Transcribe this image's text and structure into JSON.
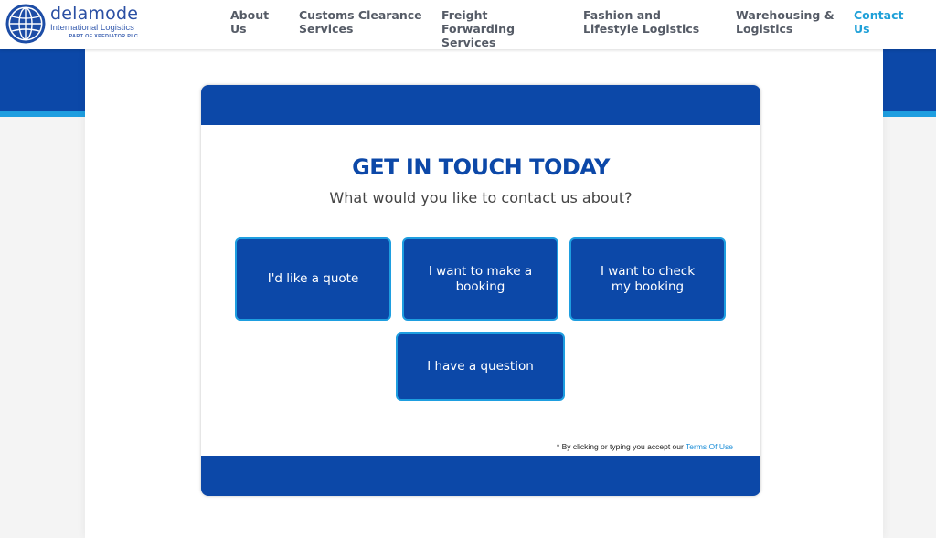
{
  "header": {
    "brand_name": "delamode",
    "brand_sub": "International Logistics",
    "brand_tag": "PART OF XPEDIATOR PLC",
    "nav": [
      {
        "label": "About Us"
      },
      {
        "label": "Customs Clearance Services"
      },
      {
        "label": "Freight Forwarding Services"
      },
      {
        "label": "Fashion and Lifestyle Logistics"
      },
      {
        "label": "Warehousing & Logistics"
      },
      {
        "label": "Contact Us",
        "active": true
      }
    ]
  },
  "contact": {
    "title": "GET IN TOUCH TODAY",
    "subtitle": "What would you like to contact us about?",
    "options": [
      {
        "label": "I'd like a quote"
      },
      {
        "label": "I want to make a booking"
      },
      {
        "label": "I want to check my booking"
      },
      {
        "label": "I have a question"
      }
    ],
    "terms_text": "* By clicking or typing you accept our",
    "terms_link": "Terms Of Use"
  },
  "colors": {
    "brand_blue": "#0c48a8",
    "accent_light_blue": "#1e9ee0",
    "nav_text": "#555b66",
    "nav_active": "#1ea0d8"
  },
  "icons": {
    "logo": "globe-icon"
  }
}
